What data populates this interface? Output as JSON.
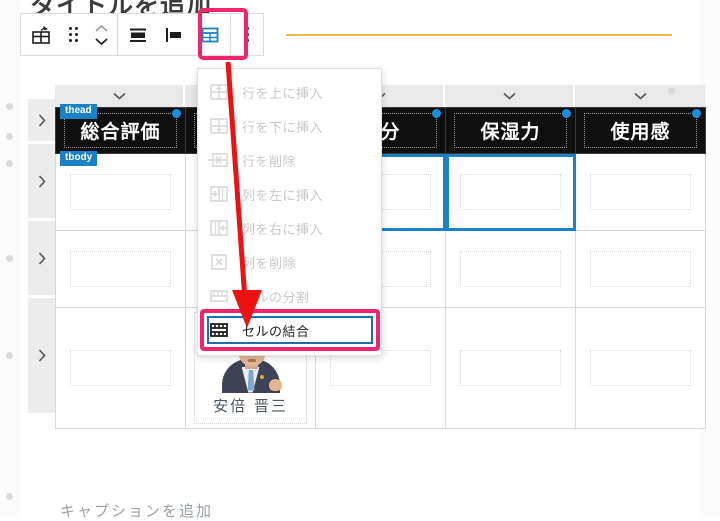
{
  "document": {
    "title": "タイトルを追加",
    "caption": "キャプションを追加"
  },
  "toolbar": {
    "buttons": [
      {
        "name": "table-block-icon",
        "label": "テーブル"
      },
      {
        "name": "drag-handle-icon",
        "label": "ドラッグ"
      },
      {
        "name": "move-up-down-icon",
        "label": "上下に移動"
      },
      {
        "name": "align-center-icon",
        "label": "中央揃え"
      },
      {
        "name": "align-left-icon",
        "label": "左揃え"
      },
      {
        "name": "edit-table-icon",
        "label": "表を編集"
      },
      {
        "name": "more-options-icon",
        "label": "その他のオプション"
      }
    ],
    "highlight_color": "#f0256e",
    "active_icon_color": "#1a82c4"
  },
  "menu": {
    "items": [
      {
        "label": "行を上に挿入",
        "icon": "insert-row-before-icon",
        "enabled": false
      },
      {
        "label": "行を下に挿入",
        "icon": "insert-row-after-icon",
        "enabled": false
      },
      {
        "label": "行を削除",
        "icon": "delete-row-icon",
        "enabled": false
      },
      {
        "label": "列を左に挿入",
        "icon": "insert-column-before-icon",
        "enabled": false
      },
      {
        "label": "列を右に挿入",
        "icon": "insert-column-after-icon",
        "enabled": false
      },
      {
        "label": "列を削除",
        "icon": "delete-column-icon",
        "enabled": false
      },
      {
        "label": "セルの分割",
        "icon": "split-cell-icon",
        "enabled": false
      },
      {
        "label": "セルの結合",
        "icon": "merge-cells-icon",
        "enabled": true
      }
    ],
    "focused_item": "セルの結合",
    "focus_outline_color": "#f0256e",
    "focus_inner_color": "#1a6fb0"
  },
  "table": {
    "structure_tags": [
      "thead",
      "tbody"
    ],
    "column_count": 5,
    "column_menu_icon": "chevron-down-icon",
    "row_handle_icon": "chevron-right-icon",
    "headers": [
      "総合評価",
      "",
      "成分",
      "保湿力",
      "使用感"
    ],
    "rows": [
      {
        "cells": [
          "",
          "",
          "",
          "",
          ""
        ]
      },
      {
        "cells": [
          "",
          "",
          "",
          "",
          ""
        ]
      },
      {
        "cells": [
          "",
          "安倍 晋三",
          "",
          "",
          ""
        ]
      }
    ],
    "photo_cell": {
      "row": 3,
      "column": 2,
      "name": "安倍 晋三",
      "image": "portrait-photo"
    },
    "selected_cells": [
      {
        "row": 1,
        "column": 3
      },
      {
        "row": 1,
        "column": 4
      }
    ],
    "selection_color": "#1a82c4",
    "header_bg": "#101010",
    "header_text_color": "#ffffff"
  },
  "annotation": {
    "arrow_color": "#ee1111",
    "arrow_points_to": "セルの結合"
  }
}
